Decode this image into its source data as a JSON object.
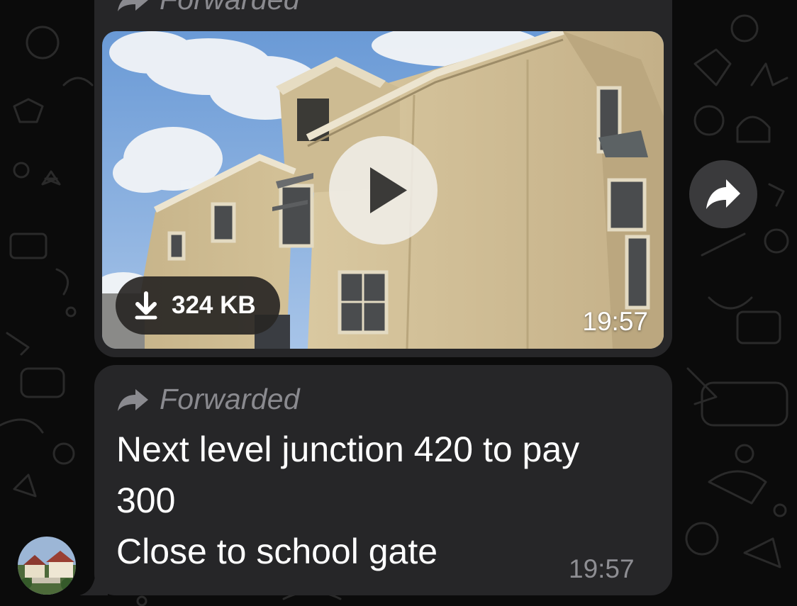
{
  "chat": {
    "messages": [
      {
        "type": "video",
        "forwarded_label": "Forwarded",
        "download_size": "324 KB",
        "time": "19:57"
      },
      {
        "type": "text",
        "forwarded_label": "Forwarded",
        "lines": [
          "Next level junction 420 to pay",
          "300",
          "Close to school gate"
        ],
        "time": "19:57"
      }
    ]
  },
  "icons": {
    "forward": "forward-arrow-icon",
    "play": "play-icon",
    "download": "download-arrow-icon",
    "share": "share-arrow-icon"
  },
  "colors": {
    "background": "#0b0b0b",
    "bubble": "#262628",
    "forwarded_text": "#8a8a8f",
    "message_text": "#ffffff",
    "timestamp": "#8e8e93",
    "share_button": "#3a3a3c"
  }
}
